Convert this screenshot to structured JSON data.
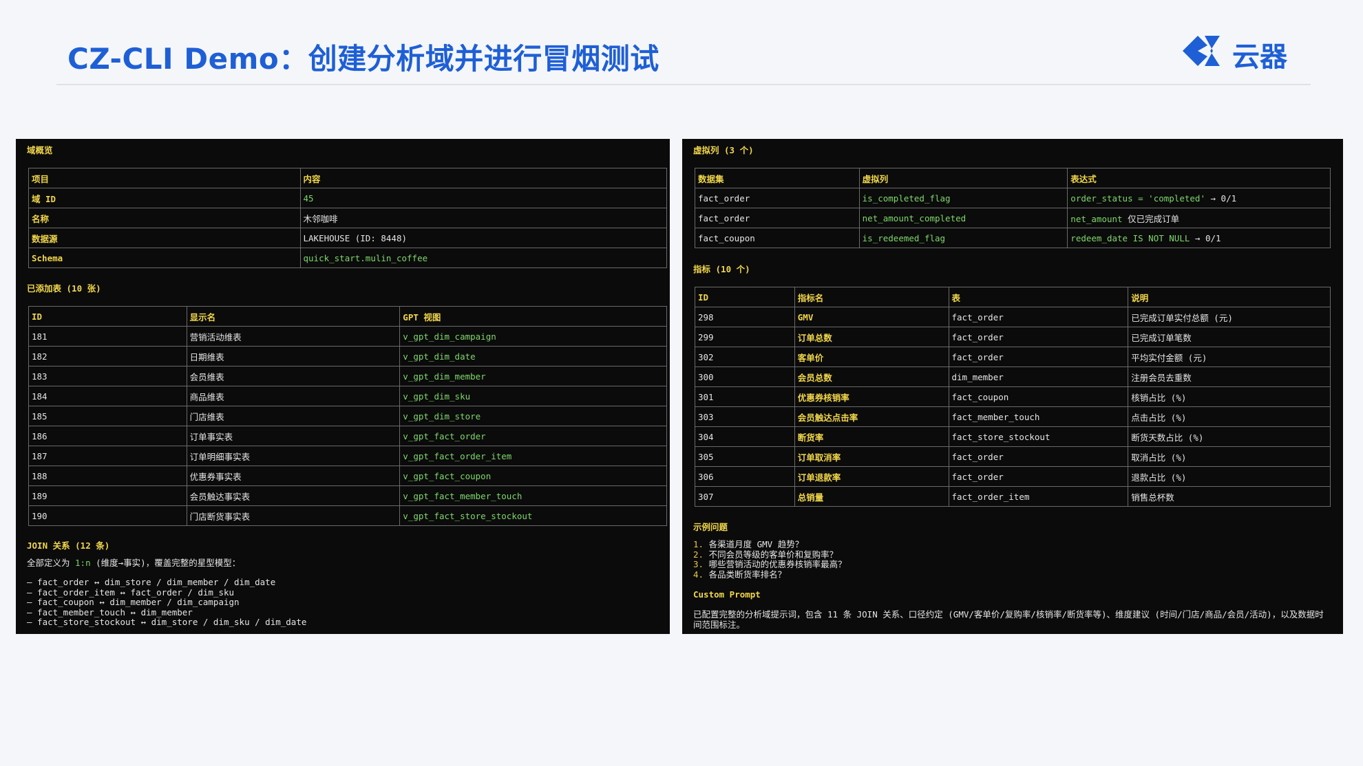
{
  "slide": {
    "title": "CZ-CLI Demo：创建分析域并进行冒烟测试",
    "logo_text": "云器",
    "accent_color": "#1e5fd6"
  },
  "left": {
    "overview": {
      "title": "域概览",
      "headers": [
        "项目",
        "内容"
      ],
      "rows": [
        {
          "key": "域 ID",
          "value": "45"
        },
        {
          "key": "名称",
          "value": "木邻咖啡"
        },
        {
          "key": "数据源",
          "value": "LAKEHOUSE (ID: 8448)"
        },
        {
          "key": "Schema",
          "value": "quick_start.mulin_coffee"
        }
      ]
    },
    "tables": {
      "title": "已添加表 (10 张)",
      "headers": [
        "ID",
        "显示名",
        "GPT 视图"
      ],
      "rows": [
        {
          "id": "181",
          "name": "营销活动维表",
          "view": "v_gpt_dim_campaign"
        },
        {
          "id": "182",
          "name": "日期维表",
          "view": "v_gpt_dim_date"
        },
        {
          "id": "183",
          "name": "会员维表",
          "view": "v_gpt_dim_member"
        },
        {
          "id": "184",
          "name": "商品维表",
          "view": "v_gpt_dim_sku"
        },
        {
          "id": "185",
          "name": "门店维表",
          "view": "v_gpt_dim_store"
        },
        {
          "id": "186",
          "name": "订单事实表",
          "view": "v_gpt_fact_order"
        },
        {
          "id": "187",
          "name": "订单明细事实表",
          "view": "v_gpt_fact_order_item"
        },
        {
          "id": "188",
          "name": "优惠券事实表",
          "view": "v_gpt_fact_coupon"
        },
        {
          "id": "189",
          "name": "会员触达事实表",
          "view": "v_gpt_fact_member_touch"
        },
        {
          "id": "190",
          "name": "门店断货事实表",
          "view": "v_gpt_fact_store_stockout"
        }
      ]
    },
    "joins": {
      "title": "JOIN 关系 (12 条)",
      "intro_prefix": "全部定义为 ",
      "intro_highlight": "1:n",
      "intro_suffix": " (维度→事实)，覆盖完整的星型模型：",
      "lines": [
        "– fact_order ↔ dim_store / dim_member / dim_date",
        "– fact_order_item ↔ fact_order / dim_sku",
        "– fact_coupon ↔ dim_member / dim_campaign",
        "– fact_member_touch ↔ dim_member",
        "– fact_store_stockout ↔ dim_store / dim_sku / dim_date"
      ]
    }
  },
  "right": {
    "virtual": {
      "title": "虚拟列 (3 个)",
      "headers": [
        "数据集",
        "虚拟列",
        "表达式"
      ],
      "rows": [
        {
          "dataset": "fact_order",
          "column": "is_completed_flag",
          "expr_code": "order_status = 'completed'",
          "expr_tail": " → 0/1"
        },
        {
          "dataset": "fact_order",
          "column": "net_amount_completed",
          "expr_code": "net_amount",
          "expr_tail": " 仅已完成订单"
        },
        {
          "dataset": "fact_coupon",
          "column": "is_redeemed_flag",
          "expr_code": "redeem_date IS NOT NULL",
          "expr_tail": " → 0/1"
        }
      ]
    },
    "metrics": {
      "title": "指标 (10 个)",
      "headers": [
        "ID",
        "指标名",
        "表",
        "说明"
      ],
      "rows": [
        {
          "id": "298",
          "name": "GMV",
          "table": "fact_order",
          "desc": "已完成订单实付总额 (元)"
        },
        {
          "id": "299",
          "name": "订单总数",
          "table": "fact_order",
          "desc": "已完成订单笔数"
        },
        {
          "id": "302",
          "name": "客单价",
          "table": "fact_order",
          "desc": "平均实付金额 (元)"
        },
        {
          "id": "300",
          "name": "会员总数",
          "table": "dim_member",
          "desc": "注册会员去重数"
        },
        {
          "id": "301",
          "name": "优惠券核销率",
          "table": "fact_coupon",
          "desc": "核销占比 (%)"
        },
        {
          "id": "303",
          "name": "会员触达点击率",
          "table": "fact_member_touch",
          "desc": "点击占比 (%)"
        },
        {
          "id": "304",
          "name": "断货率",
          "table": "fact_store_stockout",
          "desc": "断货天数占比 (%)"
        },
        {
          "id": "305",
          "name": "订单取消率",
          "table": "fact_order",
          "desc": "取消占比 (%)"
        },
        {
          "id": "306",
          "name": "订单退款率",
          "table": "fact_order",
          "desc": "退款占比 (%)"
        },
        {
          "id": "307",
          "name": "总销量",
          "table": "fact_order_item",
          "desc": "销售总杯数"
        }
      ]
    },
    "questions": {
      "title": "示例问题",
      "items": [
        {
          "num": "1.",
          "text": " 各渠道月度 GMV 趋势？"
        },
        {
          "num": "2.",
          "text": " 不同会员等级的客单价和复购率？"
        },
        {
          "num": "3.",
          "text": " 哪些营销活动的优惠券核销率最高？"
        },
        {
          "num": "4.",
          "text": " 各品类断货率排名？"
        }
      ]
    },
    "custom_prompt": {
      "title": "Custom Prompt",
      "text": "已配置完整的分析域提示词，包含 11 条 JOIN 关系、口径约定 (GMV/客单价/复购率/核销率/断货率等)、维度建议 (时间/门店/商品/会员/活动)，以及数据时间范围标注。"
    }
  }
}
